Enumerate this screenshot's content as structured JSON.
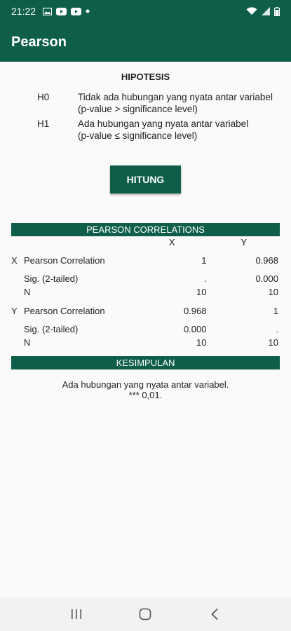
{
  "status_bar": {
    "time": "21:22",
    "icons": [
      "image-icon",
      "youtube-icon",
      "youtube-icon",
      "dot-icon",
      "wifi-icon",
      "signal-icon",
      "battery-icon"
    ]
  },
  "app_bar": {
    "title": "Pearson"
  },
  "hipotesis": {
    "title": "HIPOTESIS",
    "h0": {
      "label": "H0",
      "text": "Tidak ada hubungan yang nyata antar variabel",
      "note": "(p-value > significance level)"
    },
    "h1": {
      "label": "H1",
      "text": "Ada hubungan yang nyata antar variabel",
      "note": "(p-value ≤ significance level)"
    }
  },
  "hitung_button": "HITUNG",
  "correlations": {
    "title": "PEARSON CORRELATIONS",
    "columns": [
      "X",
      "Y"
    ],
    "groups": [
      {
        "name": "X",
        "rows": [
          {
            "label": "Pearson Correlation",
            "x": "1",
            "y": "0.968"
          },
          {
            "label": "Sig. (2-tailed)",
            "x": ".",
            "y": "0.000"
          },
          {
            "label": "N",
            "x": "10",
            "y": "10"
          }
        ]
      },
      {
        "name": "Y",
        "rows": [
          {
            "label": "Pearson Correlation",
            "x": "0.968",
            "y": "1"
          },
          {
            "label": "Sig. (2-tailed)",
            "x": "0.000",
            "y": "."
          },
          {
            "label": "N",
            "x": "10",
            "y": "10"
          }
        ]
      }
    ]
  },
  "kesimpulan": {
    "title": "KESIMPULAN",
    "line1": "Ada hubungan yang nyata antar variabel.",
    "line2": "*** 0,01."
  },
  "nav_bar": {
    "icons": [
      "recents-icon",
      "home-icon",
      "back-icon"
    ]
  },
  "colors": {
    "primary": "#0f5e4a",
    "background": "#fafafa",
    "nav_background": "#f2f2f2"
  }
}
